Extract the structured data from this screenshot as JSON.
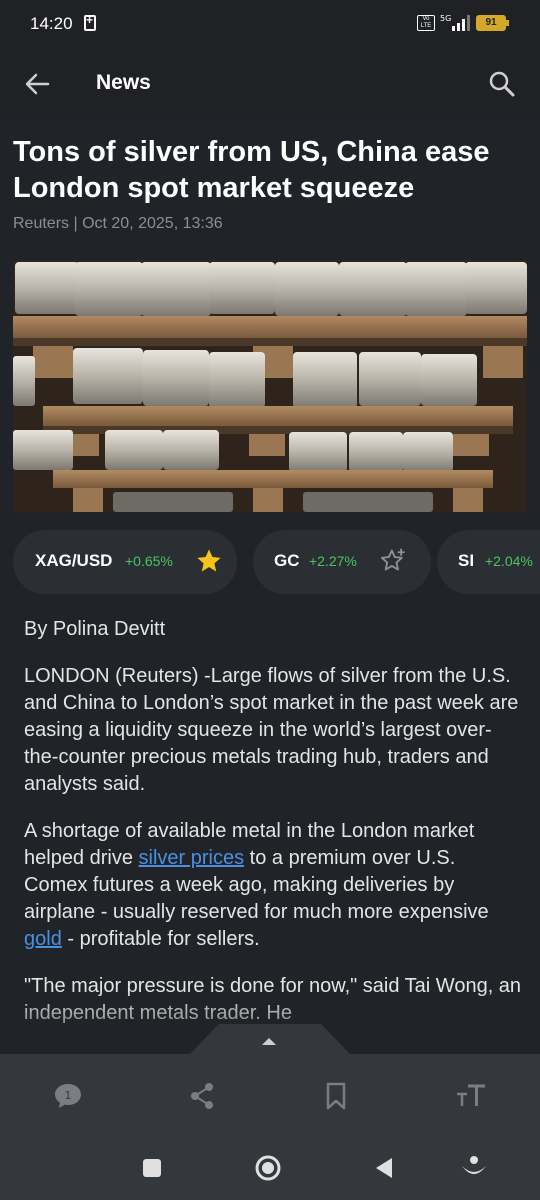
{
  "status": {
    "time": "14:20",
    "network_label": "5G",
    "volte_label": "Vo LTE",
    "battery": "91"
  },
  "appbar": {
    "title": "News"
  },
  "article": {
    "headline": "Tons of silver from US, China ease London spot market squeeze",
    "meta": "Reuters | Oct 20, 2025, 13:36",
    "author": "By Polina Devitt",
    "p1": "LONDON (Reuters) -Large flows of silver from the U.S. and China to London’s spot market in the past week are easing a liquidity squeeze in the world’s largest over-the-counter precious metals trading hub, traders and analysts said.",
    "p2_before": "A shortage of available metal in the London market helped drive ",
    "p2_link1": "silver prices",
    "p2_mid": " to a premium over U.S. Comex futures a week ago, making deliveries by airplane - usually reserved for much more expensive ",
    "p2_link2": "gold",
    "p2_after": " - profitable for sellers.",
    "p3": "\"The major pressure is done for now,\" said Tai Wong, an independent metals trader. He"
  },
  "tickers": [
    {
      "symbol": "XAG/USD",
      "change": "+0.65%",
      "starred": true
    },
    {
      "symbol": "GC",
      "change": "+2.27%",
      "starred": false
    },
    {
      "symbol": "SI",
      "change": "+2.04%",
      "starred": false
    }
  ],
  "bottom_toolbar": {
    "comment_count": "1",
    "icons": [
      "comment-icon",
      "share-icon",
      "bookmark-icon",
      "text-size-icon"
    ]
  },
  "colors": {
    "background": "#202327",
    "bar": "#34373b",
    "positive": "#49c460",
    "link": "#4a90e2",
    "star": "#f5c518"
  }
}
